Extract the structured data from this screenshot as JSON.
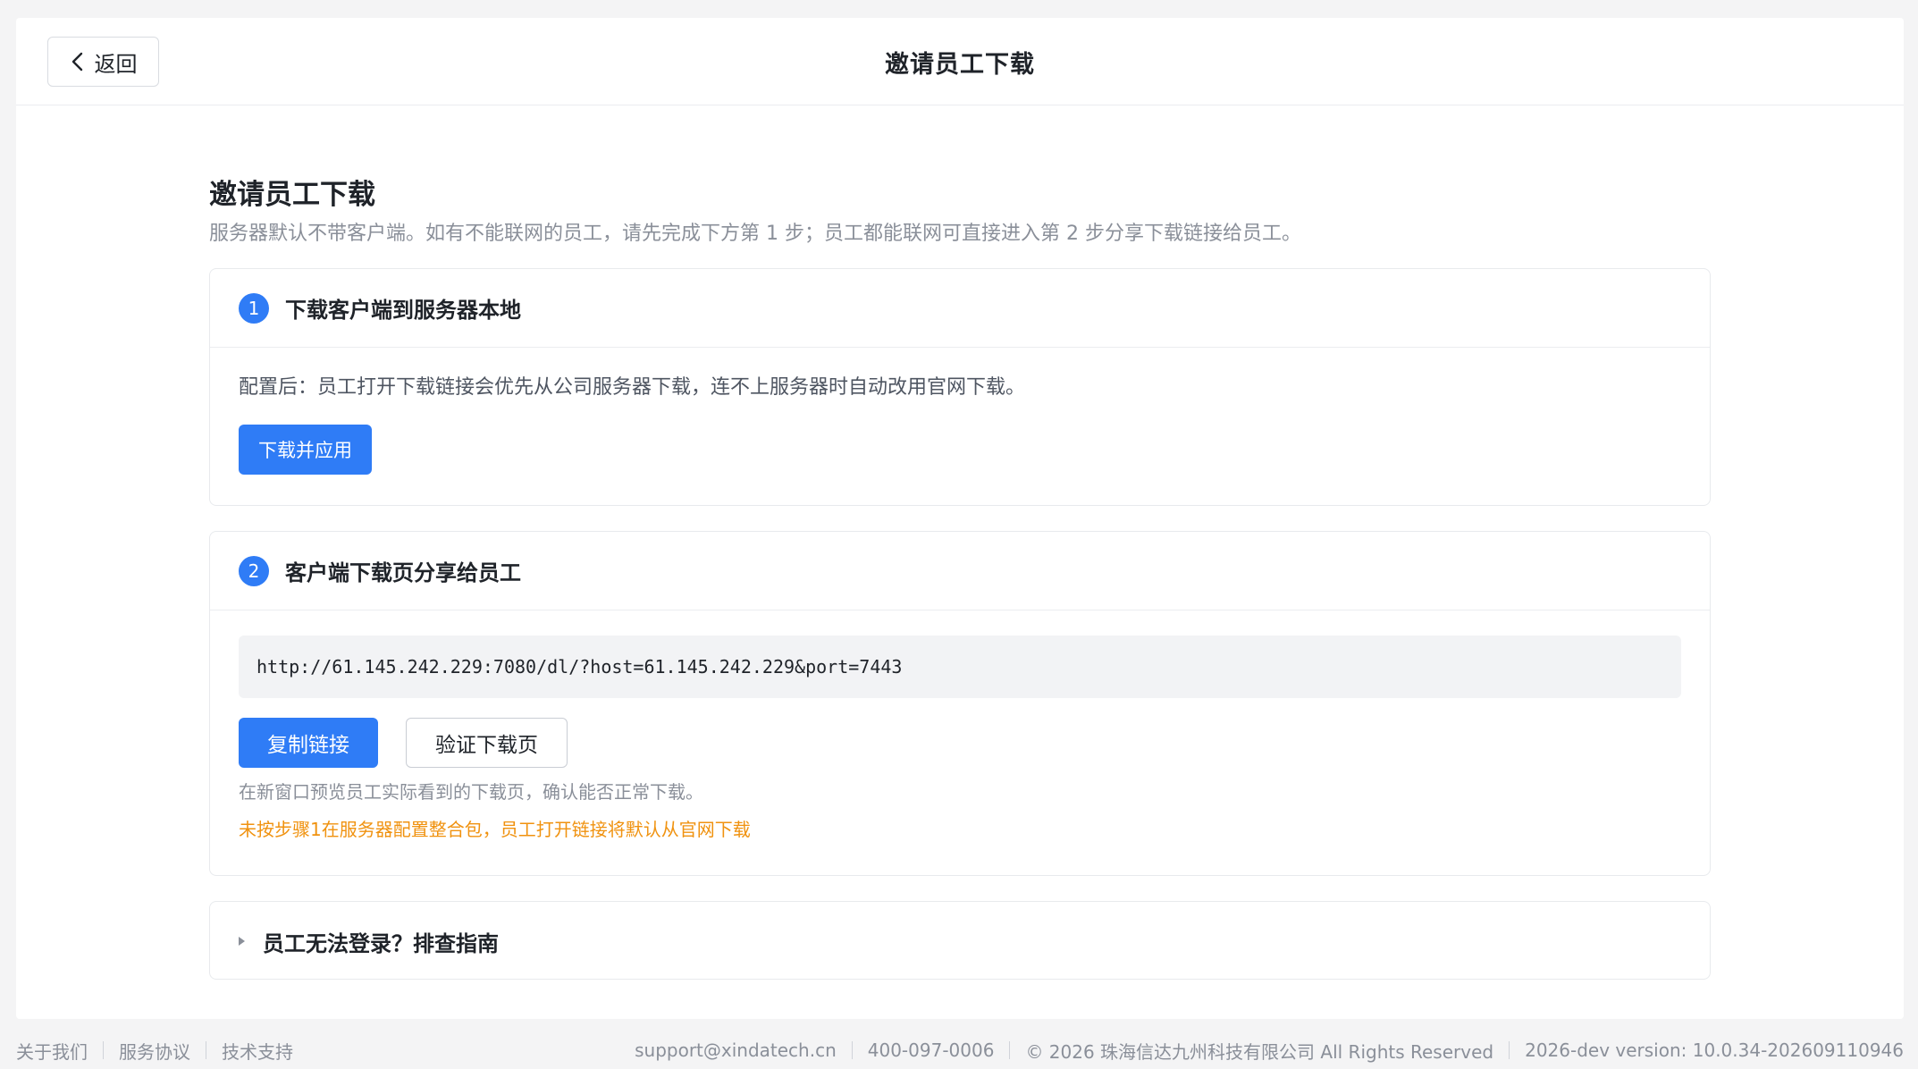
{
  "header": {
    "back_label": "返回",
    "title": "邀请员工下载"
  },
  "main": {
    "title": "邀请员工下载",
    "description": "服务器默认不带客户端。如有不能联网的员工，请先完成下方第 1 步；员工都能联网可直接进入第 2 步分享下载链接给员工。"
  },
  "step1": {
    "number": "1",
    "title": "下载客户端到服务器本地",
    "text": "配置后：员工打开下载链接会优先从公司服务器下载，连不上服务器时自动改用官网下载。",
    "button_label": "下载并应用"
  },
  "step2": {
    "number": "2",
    "title": "客户端下载页分享给员工",
    "link": "http://61.145.242.229:7080/dl/?host=61.145.242.229&port=7443",
    "copy_label": "复制链接",
    "verify_label": "验证下载页",
    "hint": "在新窗口预览员工实际看到的下载页，确认能否正常下载。",
    "warning": "未按步骤1在服务器配置整合包，员工打开链接将默认从官网下载"
  },
  "guide": {
    "title": "员工无法登录？排查指南"
  },
  "footer": {
    "links": [
      "关于我们",
      "服务协议",
      "技术支持"
    ],
    "email": "support@xindatech.cn",
    "phone": "400-097-0006",
    "copyright": "© 2026 珠海信达九州科技有限公司 All Rights Reserved",
    "version": "2026-dev version: 10.0.34-202609110946"
  },
  "colors": {
    "primary": "#2f7cf6",
    "warning": "#f0920f",
    "muted": "#8a8f99"
  }
}
